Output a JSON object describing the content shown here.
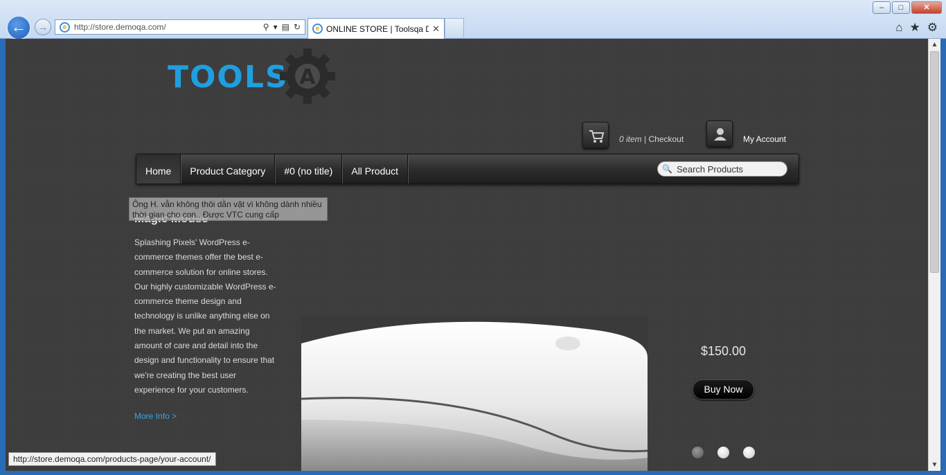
{
  "browser": {
    "address_url": "http://store.demoqa.com/",
    "tab_title": "ONLINE STORE | Toolsqa D...",
    "status_url": "http://store.demoqa.com/products-page/your-account/"
  },
  "site": {
    "logo_text": "TOOLS",
    "logo_mark": "A",
    "cart": {
      "count_text": "0 item",
      "separator": " | ",
      "checkout_label": "Checkout"
    },
    "account_label": "My Account",
    "nav": [
      "Home",
      "Product Category",
      "#0 (no title)",
      "All Product"
    ],
    "search_placeholder": "Search Products"
  },
  "slide": {
    "title": "Magic Mouse",
    "description": "Splashing Pixels' WordPress e-commerce themes offer the best e-commerce solution for online stores. Our highly customizable WordPress e-commerce theme design and technology is unlike anything else on the market. We put an amazing amount of care and detail into the design and functionality to ensure that we're creating the best user experience for your customers.",
    "more_info": "More Info >",
    "price": "$150.00",
    "buy_label": "Buy Now"
  },
  "tooltip_text": "Ông H. vẫn không thôi dằn vặt vì không dành nhiều thời gian cho con.. Được VTC cung cấp",
  "colors": {
    "accent": "#1f9fe0",
    "link": "#3aa3df",
    "background": "#3a3a3a"
  }
}
